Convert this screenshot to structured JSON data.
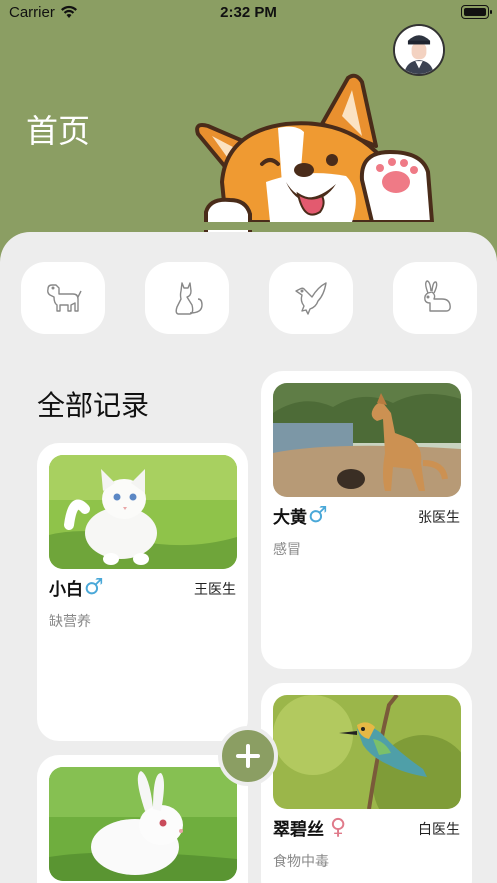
{
  "status_bar": {
    "carrier": "Carrier",
    "time": "2:32 PM"
  },
  "header": {
    "title": "首页",
    "avatar": "user-avatar",
    "mascot": "corgi-illustration"
  },
  "categories": [
    {
      "icon": "dog-icon"
    },
    {
      "icon": "cat-icon"
    },
    {
      "icon": "bird-icon"
    },
    {
      "icon": "rabbit-icon"
    }
  ],
  "records": {
    "title": "全部记录",
    "items": [
      {
        "name": "小白",
        "gender": "♂",
        "gender_color": "#4aa8d8",
        "doctor": "王医生",
        "diagnosis": "缺营养",
        "photo": "white-kitten"
      },
      {
        "name": "大黄",
        "gender": "♂",
        "gender_color": "#4aa8d8",
        "doctor": "张医生",
        "diagnosis": "感冒",
        "photo": "yellow-dog"
      },
      {
        "name": "翠碧丝",
        "gender": "♀",
        "gender_color": "#e07a8a",
        "doctor": "白医生",
        "diagnosis": "食物中毒",
        "photo": "green-bird"
      },
      {
        "name": "",
        "gender": "",
        "doctor": "",
        "diagnosis": "",
        "photo": "white-rabbit"
      }
    ]
  },
  "fab": {
    "icon": "plus-icon"
  },
  "colors": {
    "primary": "#8b9e63",
    "background": "#ededed",
    "male": "#4aa8d8",
    "female": "#e07a8a"
  }
}
